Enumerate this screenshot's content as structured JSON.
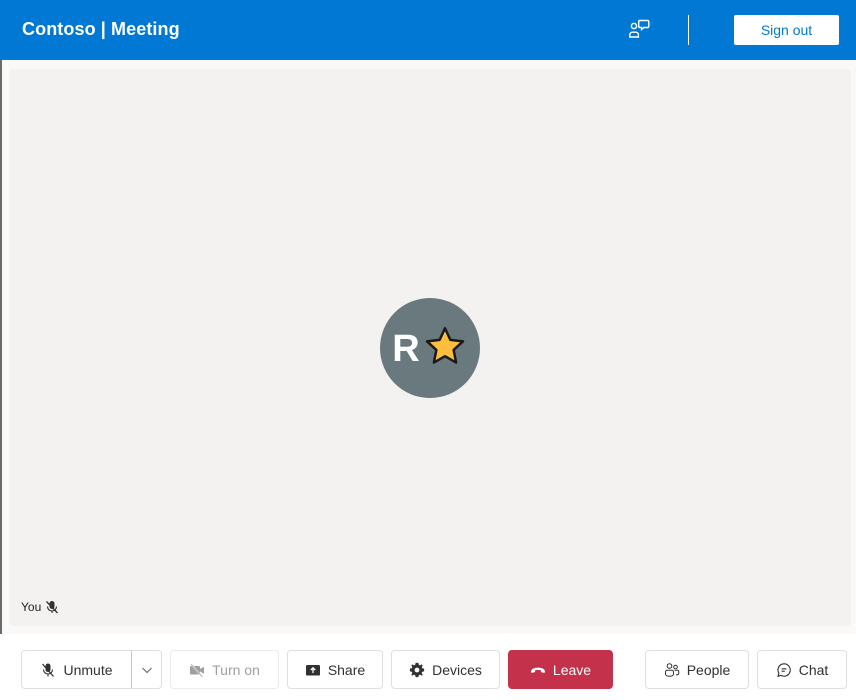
{
  "header": {
    "title": "Contoso | Meeting",
    "feedback_icon": "people-chat-icon",
    "sign_out_label": "Sign out"
  },
  "stage": {
    "avatar": {
      "initial": "R",
      "emoji": "star",
      "background": "#69797e"
    },
    "self_label": "You",
    "self_status_icon": "mic-off-icon"
  },
  "controls": {
    "unmute": {
      "label": "Unmute",
      "icon": "mic-off-icon"
    },
    "audio_options": {
      "icon": "chevron-down-icon"
    },
    "camera": {
      "label": "Turn on",
      "icon": "video-off-icon",
      "disabled": true
    },
    "share": {
      "label": "Share",
      "icon": "share-screen-icon"
    },
    "devices": {
      "label": "Devices",
      "icon": "gear-icon"
    },
    "leave": {
      "label": "Leave",
      "icon": "hang-up-icon",
      "color": "#c4314b"
    },
    "people": {
      "label": "People",
      "icon": "people-icon"
    },
    "chat": {
      "label": "Chat",
      "icon": "chat-icon"
    }
  },
  "colors": {
    "brand": "#0078d4",
    "stage_bg": "#f3f2f1",
    "leave": "#c4314b"
  }
}
